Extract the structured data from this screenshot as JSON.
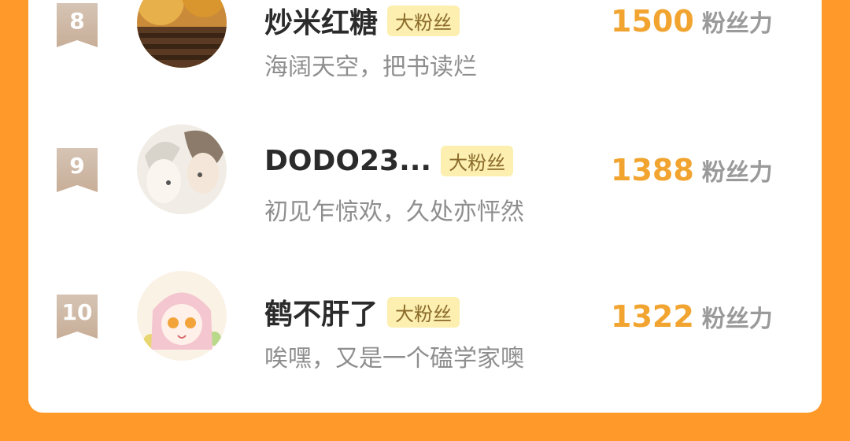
{
  "rows": [
    {
      "rank": "8",
      "name": "炒米红糖",
      "tag": "大粉丝",
      "motto": "海阔天空，把书读烂",
      "score": "1500",
      "unit": "粉丝力"
    },
    {
      "rank": "9",
      "name": "DODO23...",
      "tag": "大粉丝",
      "motto": "初见乍惊欢，久处亦怦然",
      "score": "1388",
      "unit": "粉丝力"
    },
    {
      "rank": "10",
      "name": "鹤不肝了",
      "tag": "大粉丝",
      "motto": "唉嘿，又是一个磕学家噢",
      "score": "1322",
      "unit": "粉丝力"
    }
  ],
  "colors": {
    "background": "#FF9A2A",
    "score": "#F2A430",
    "tag_bg": "#FCEFB0"
  }
}
